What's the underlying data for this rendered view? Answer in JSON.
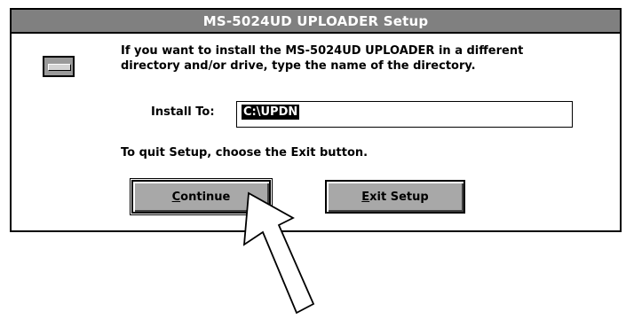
{
  "window": {
    "title": "MS-5024UD UPLOADER Setup"
  },
  "message": {
    "line1": "If you want to install the MS-5024UD UPLOADER in a different",
    "line2": "directory and/or drive, type the name of the directory."
  },
  "install": {
    "label": "Install To:",
    "value": "C:\\UPDN"
  },
  "quit_text": "To quit Setup, choose the Exit button.",
  "buttons": {
    "continue": {
      "mnemonic": "C",
      "rest": "ontinue"
    },
    "exit": {
      "mnemonic": "E",
      "rest": "xit Setup"
    }
  },
  "icons": {
    "system_menu": "system-menu-icon",
    "cursor": "arrow-cursor-icon"
  },
  "colors": {
    "titlebar": "#808080",
    "button_face": "#a8a8a8",
    "selection": "#000000"
  }
}
